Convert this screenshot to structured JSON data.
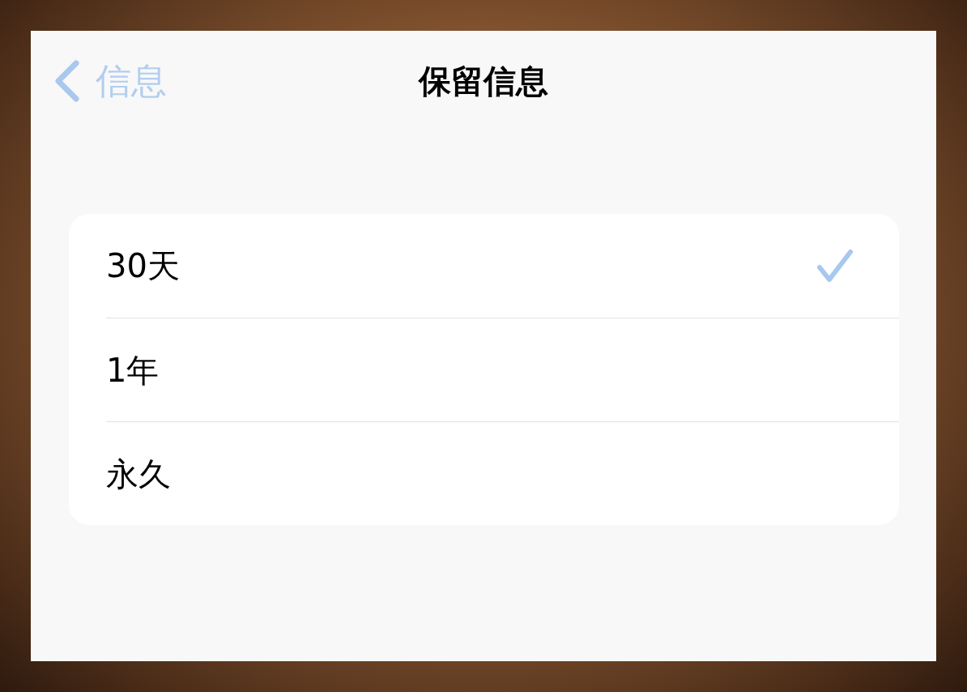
{
  "nav_bar": {
    "back_button": {
      "label": "信息"
    },
    "title": "保留信息"
  },
  "options": [
    {
      "label": "30天",
      "selected": true
    },
    {
      "label": "1年",
      "selected": false
    },
    {
      "label": "永久",
      "selected": false
    }
  ]
}
